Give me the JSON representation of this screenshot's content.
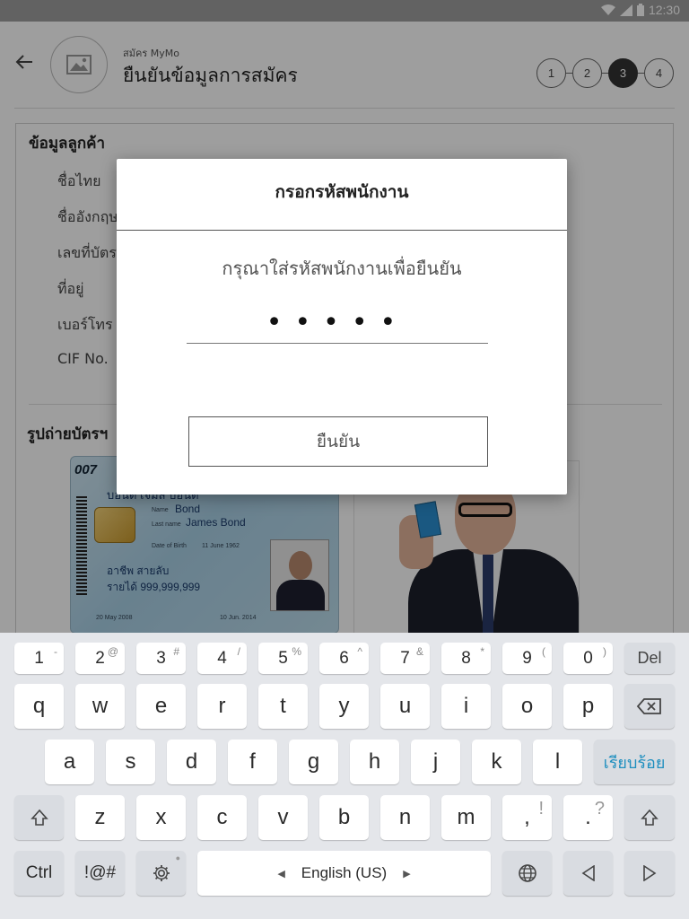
{
  "status_bar": {
    "time": "12:30"
  },
  "header": {
    "subtitle": "สมัคร MyMo",
    "title": "ยืนยันข้อมูลการสมัคร",
    "steps": [
      "1",
      "2",
      "3",
      "4"
    ],
    "active_step": "3"
  },
  "customer_section": {
    "title": "ข้อมูลลูกค้า",
    "fields": [
      "ชื่อไทย",
      "ชื่ออังกฤษ",
      "เลขที่บัตร",
      "ที่อยู่",
      "เบอร์โทร",
      "CIF No."
    ]
  },
  "photo_section": {
    "title": "รูปถ่ายบัตรฯ"
  },
  "id_card": {
    "logo": "007",
    "thai_name": "บอนด์ เจมส์ บอนด์",
    "name_label": "Name",
    "name": "Bond",
    "last_name_label": "Last name",
    "last_name": "James Bond",
    "dob_label": "Date of Birth",
    "dob": "11 June 1962",
    "occupation": "อาชีพ สายลับ",
    "income": "รายได้ 999,999,999",
    "issue_date": "20 May 2008",
    "expiry_date": "10 Jun. 2014"
  },
  "dialog": {
    "title": "กรอกรหัสพนักงาน",
    "message": "กรุณาใส่รหัสพนักงานเพื่อยืนยัน",
    "password_value": "•••••",
    "confirm_label": "ยืนยัน"
  },
  "keyboard": {
    "number_row": [
      {
        "key": "1",
        "alt": "-"
      },
      {
        "key": "2",
        "alt": "@"
      },
      {
        "key": "3",
        "alt": "#"
      },
      {
        "key": "4",
        "alt": "/"
      },
      {
        "key": "5",
        "alt": "%"
      },
      {
        "key": "6",
        "alt": "^"
      },
      {
        "key": "7",
        "alt": "&"
      },
      {
        "key": "8",
        "alt": "*"
      },
      {
        "key": "9",
        "alt": "("
      },
      {
        "key": "0",
        "alt": ")"
      }
    ],
    "del_label": "Del",
    "row1": [
      "q",
      "w",
      "e",
      "r",
      "t",
      "y",
      "u",
      "i",
      "o",
      "p"
    ],
    "row2": [
      "a",
      "s",
      "d",
      "f",
      "g",
      "h",
      "j",
      "k",
      "l"
    ],
    "done_label": "เรียบร้อย",
    "row3": [
      "z",
      "x",
      "c",
      "v",
      "b",
      "n",
      "m"
    ],
    "comma": ",",
    "comma_alt": "!",
    "period": ".",
    "period_alt": "?",
    "ctrl_label": "Ctrl",
    "symbols_label": "!@#",
    "space_label": "English (US)"
  }
}
